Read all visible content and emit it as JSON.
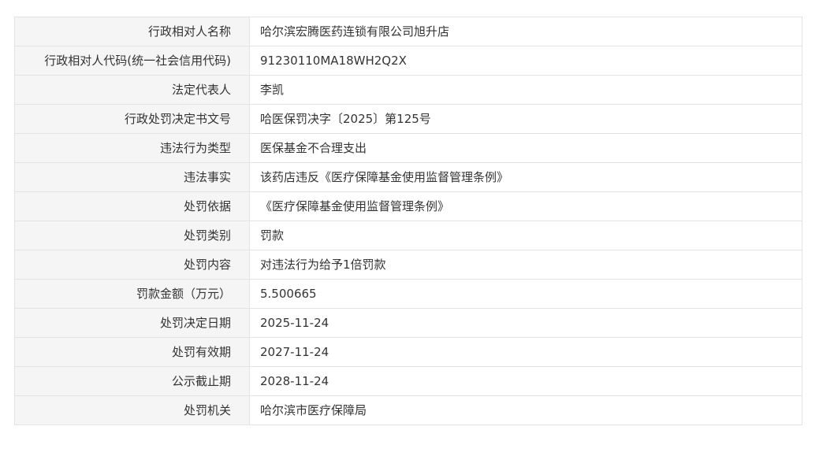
{
  "rows": [
    {
      "label": "行政相对人名称",
      "value": "哈尔滨宏腾医药连锁有限公司旭升店"
    },
    {
      "label": "行政相对人代码(统一社会信用代码)",
      "value": "91230110MA18WH2Q2X"
    },
    {
      "label": "法定代表人",
      "value": "李凯"
    },
    {
      "label": "行政处罚决定书文号",
      "value": "哈医保罚决字〔2025〕第125号"
    },
    {
      "label": "违法行为类型",
      "value": "医保基金不合理支出"
    },
    {
      "label": "违法事实",
      "value": "该药店违反《医疗保障基金使用监督管理条例》"
    },
    {
      "label": "处罚依据",
      "value": "《医疗保障基金使用监督管理条例》"
    },
    {
      "label": "处罚类别",
      "value": "罚款"
    },
    {
      "label": "处罚内容",
      "value": "对违法行为给予1倍罚款"
    },
    {
      "label": "罚款金额（万元）",
      "value": "5.500665"
    },
    {
      "label": "处罚决定日期",
      "value": "2025-11-24"
    },
    {
      "label": "处罚有效期",
      "value": "2027-11-24"
    },
    {
      "label": "公示截止期",
      "value": "2028-11-24"
    },
    {
      "label": "处罚机关",
      "value": "哈尔滨市医疗保障局"
    }
  ]
}
